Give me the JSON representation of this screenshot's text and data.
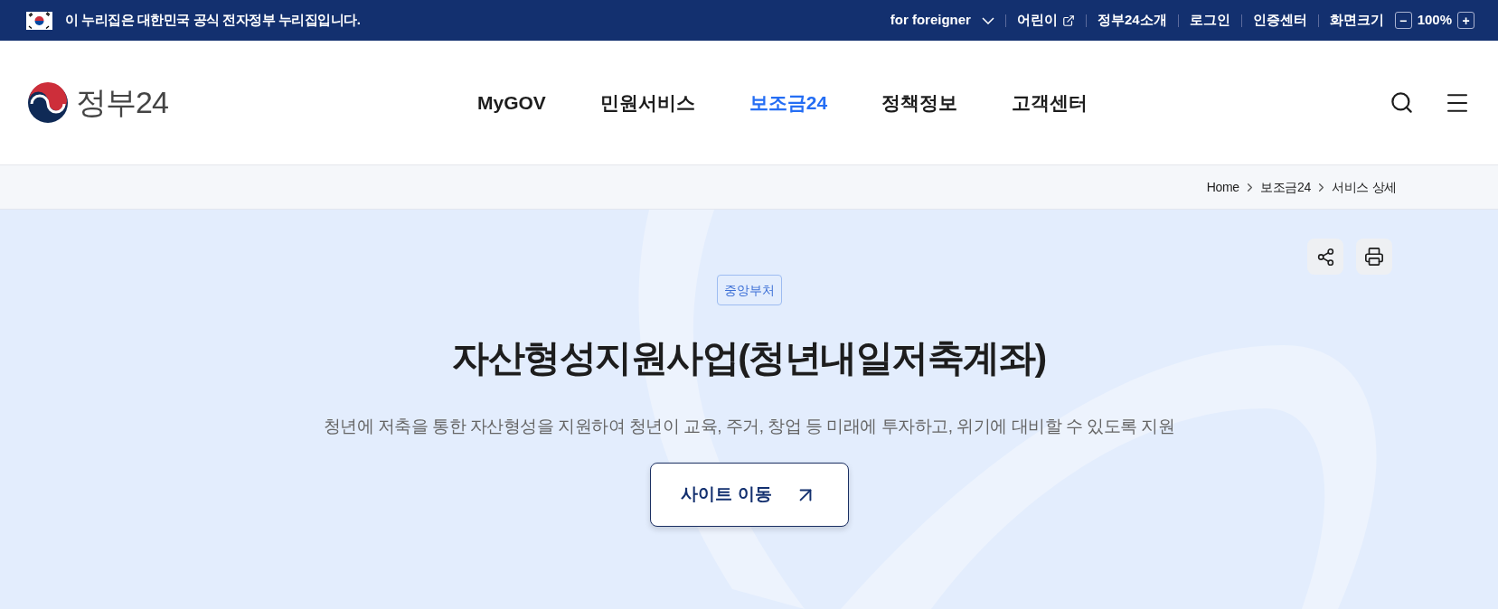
{
  "official_banner": {
    "text": "이 누리집은 대한민국 공식 전자정부 누리집입니다."
  },
  "utility_links": [
    {
      "kind": "dropdown",
      "label": "for foreigner"
    },
    {
      "kind": "external",
      "label": "어린이"
    },
    {
      "kind": "link",
      "label": "정부24소개"
    },
    {
      "kind": "link",
      "label": "로그인"
    },
    {
      "kind": "link",
      "label": "인증센터"
    },
    {
      "kind": "zoom",
      "label": "화면크기",
      "minus": "−",
      "value": "100%",
      "plus": "+"
    }
  ],
  "logo": {
    "text": "정부24"
  },
  "nav": [
    {
      "label": "MyGOV",
      "selected": false
    },
    {
      "label": "민원서비스",
      "selected": false
    },
    {
      "label": "보조금24",
      "selected": true
    },
    {
      "label": "정책정보",
      "selected": false
    },
    {
      "label": "고객센터",
      "selected": false
    }
  ],
  "breadcrumb": [
    "Home",
    "보조금24",
    "서비스 상세"
  ],
  "service": {
    "badge": "중앙부처",
    "title": "자산형성지원사업(청년내일저축계좌)",
    "description": "청년에 저축을 통한 자산형성을 지원하여 청년이 교육, 주거, 창업 등 미래에 투자하고, 위기에 대비할 수 있도록 지원",
    "button": "사이트 이동"
  }
}
